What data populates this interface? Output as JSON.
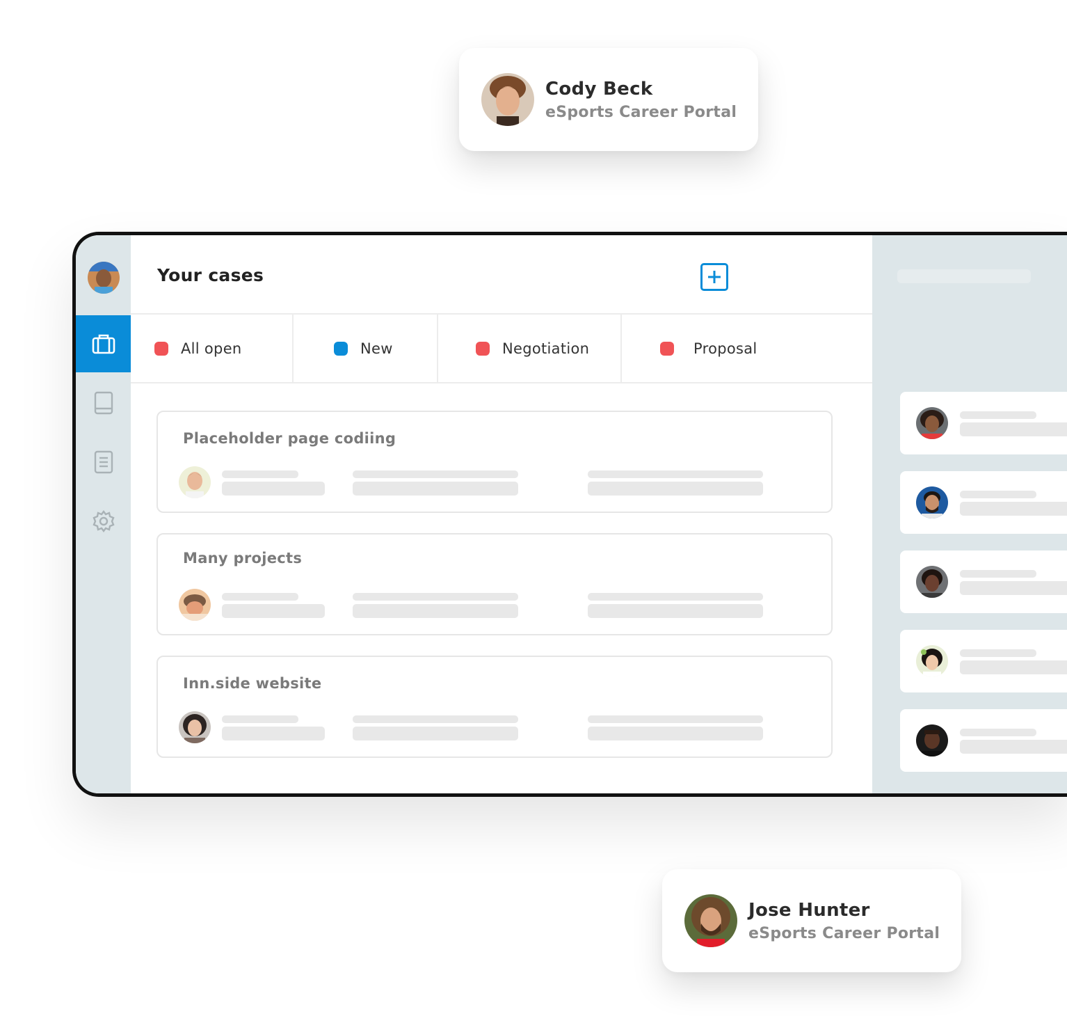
{
  "top_card": {
    "name": "Cody Beck",
    "subtitle": "eSports Career Portal"
  },
  "bottom_card": {
    "name": "Jose Hunter",
    "subtitle": "eSports Career Portal"
  },
  "main": {
    "title": "Your cases",
    "tabs": [
      {
        "label": "All open",
        "color": "#f05356"
      },
      {
        "label": "New",
        "color": "#0a8cd8"
      },
      {
        "label": "Negotiation",
        "color": "#f05356"
      },
      {
        "label": "Proposal",
        "color": "#f05356"
      }
    ],
    "cases": [
      {
        "title": "Placeholder page codiing"
      },
      {
        "title": "Many projects"
      },
      {
        "title": "Inn.side website"
      }
    ]
  },
  "sidebar": {
    "items": [
      {
        "icon": "briefcase-icon",
        "active": true
      },
      {
        "icon": "book-icon",
        "active": false
      },
      {
        "icon": "document-icon",
        "active": false
      },
      {
        "icon": "gear-icon",
        "active": false
      }
    ]
  },
  "colors": {
    "accent": "#0a8cd8",
    "panel": "#dde6e9",
    "status_red": "#f05356"
  }
}
